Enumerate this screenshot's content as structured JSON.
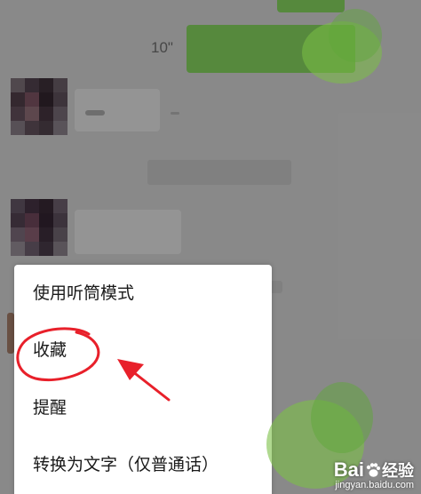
{
  "chat": {
    "voice_duration": "10\""
  },
  "context_menu": {
    "items": [
      {
        "label": "使用听筒模式"
      },
      {
        "label": "收藏"
      },
      {
        "label": "提醒"
      },
      {
        "label": "转换为文字（仅普通话）"
      }
    ]
  },
  "watermark": {
    "brand": "Bai",
    "brand_suffix": "经验",
    "url": "jingyan.baidu.com"
  },
  "colors": {
    "sent_bubble": "#95ec69",
    "annotation": "#e8202a",
    "overlay": "rgba(0,0,0,0.42)"
  }
}
